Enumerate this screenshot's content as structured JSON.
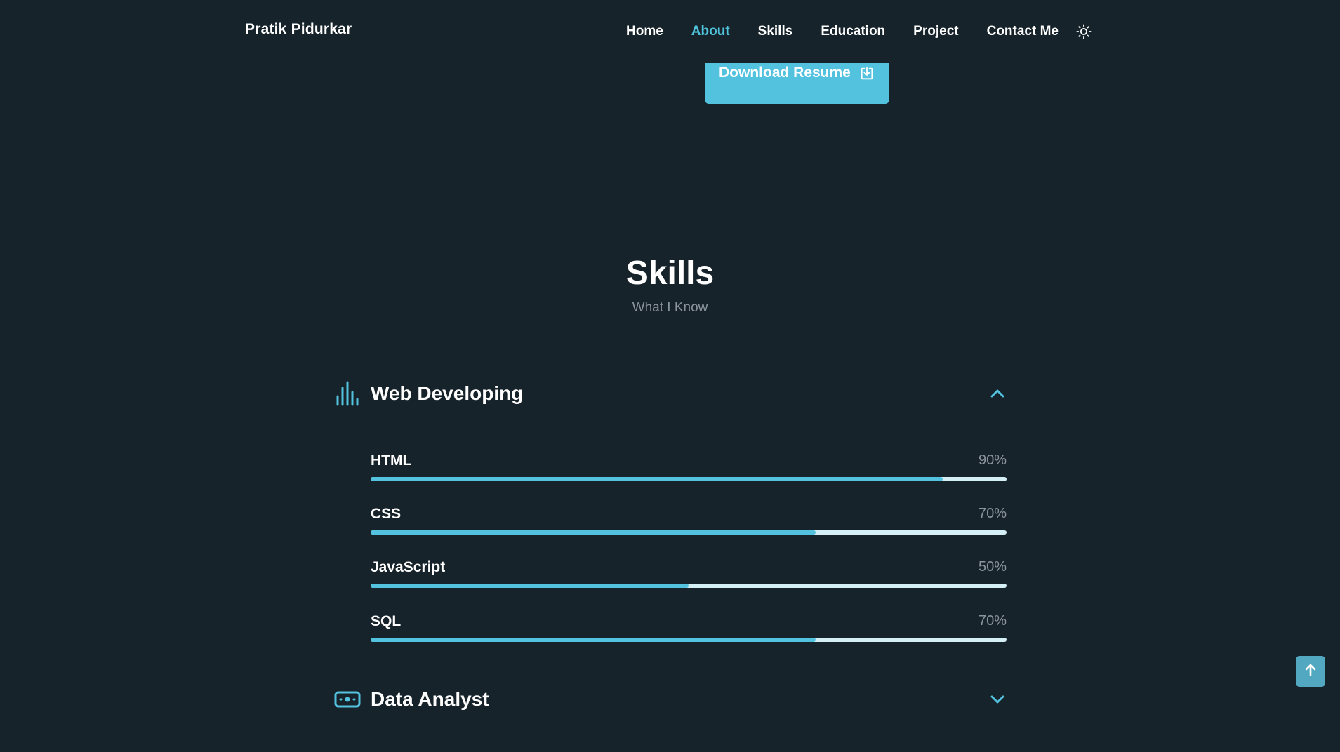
{
  "header": {
    "brand": "Pratik Pidurkar",
    "nav": [
      "Home",
      "About",
      "Skills",
      "Education",
      "Project",
      "Contact Me"
    ],
    "active_nav": "About",
    "theme_icon": "sun-icon"
  },
  "hero": {
    "download_label": "Download Resume",
    "download_icon": "download-icon"
  },
  "skills_section": {
    "title": "Skills",
    "subtitle": "What I Know",
    "groups": [
      {
        "title": "Web Developing",
        "icon": "bar-chart-icon",
        "expanded": true,
        "items": [
          {
            "name": "HTML",
            "percent_label": "90%",
            "percent": 90
          },
          {
            "name": "CSS",
            "percent_label": "70%",
            "percent": 70
          },
          {
            "name": "JavaScript",
            "percent_label": "50%",
            "percent": 50
          },
          {
            "name": "SQL",
            "percent_label": "70%",
            "percent": 70
          }
        ]
      },
      {
        "title": "Data Analyst",
        "icon": "money-icon",
        "expanded": false,
        "items": []
      }
    ]
  },
  "colors": {
    "background": "#17232a",
    "accent": "#52c2df",
    "bar_track": "#d4eff6",
    "muted_text": "#8a949a"
  },
  "scroll_up_icon": "arrow-up-icon"
}
